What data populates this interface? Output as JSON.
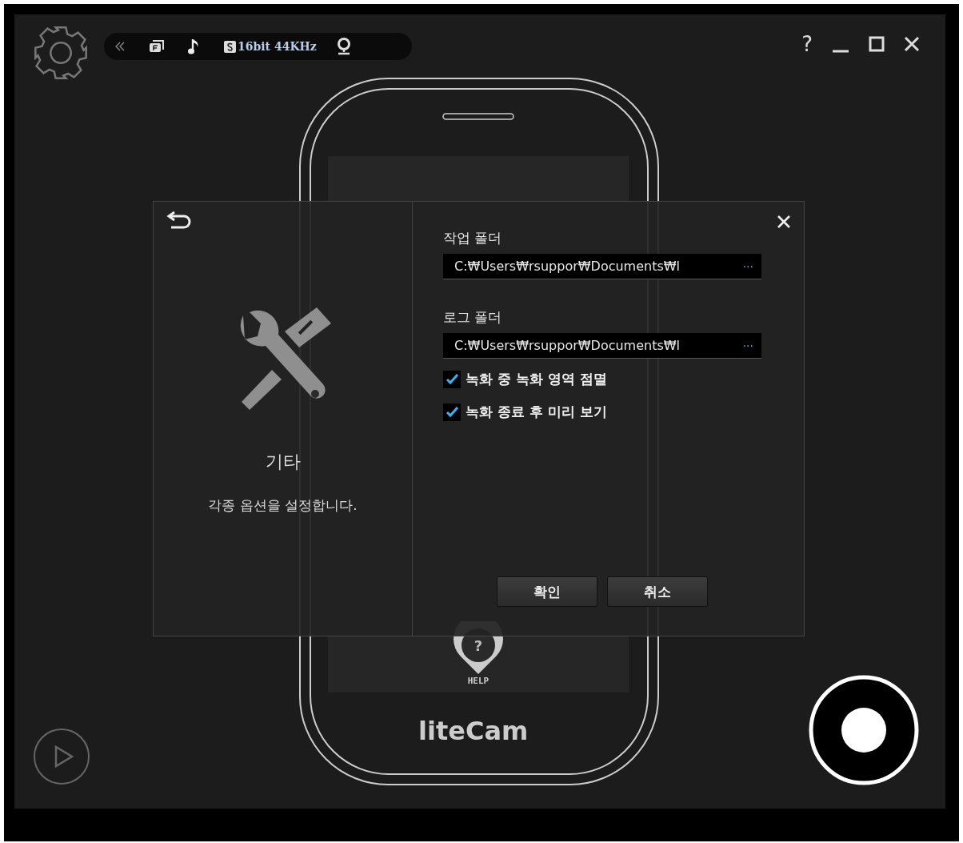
{
  "toolbar": {
    "audio_format": "16bit 44KHz"
  },
  "window_controls": {
    "help": "?"
  },
  "phone": {
    "help_mark": "?",
    "help_label": "HELP",
    "brand": "liteCam"
  },
  "dialog": {
    "category_title": "기타",
    "category_description": "각종 옵션을 설정합니다.",
    "fields": [
      {
        "label": "작업 폴더",
        "value": "C:₩Users₩rsuppor₩Documents₩l",
        "browse": "···"
      },
      {
        "label": "로그 폴더",
        "value": "C:₩Users₩rsuppor₩Documents₩l",
        "browse": "···"
      }
    ],
    "options": [
      {
        "label": "녹화 중 녹화 영역 점멸",
        "checked": true
      },
      {
        "label": "녹화 종료 후 미리 보기",
        "checked": true
      }
    ],
    "buttons": [
      "확인",
      "취소"
    ]
  }
}
